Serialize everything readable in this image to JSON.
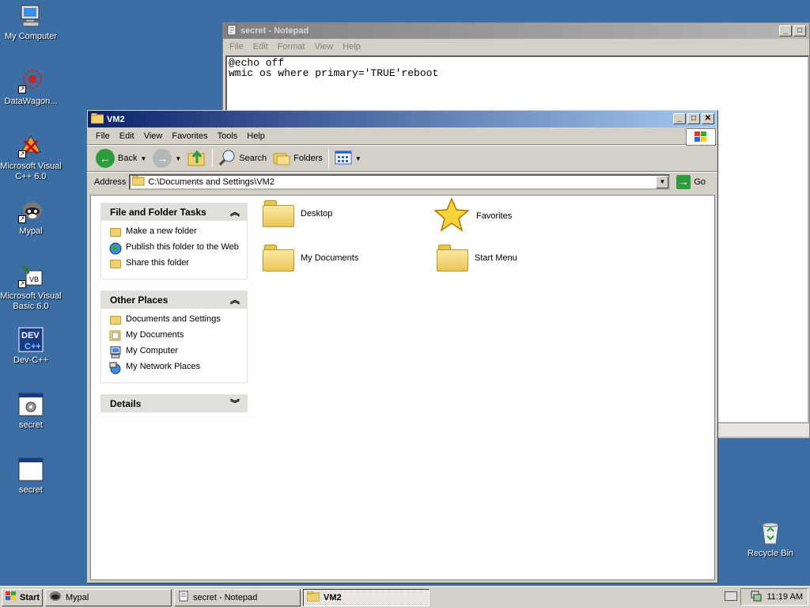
{
  "desktop": {
    "icons": [
      {
        "label": "My Computer"
      },
      {
        "label": "DataWagon..."
      },
      {
        "label": "Microsoft Visual C++ 6.0"
      },
      {
        "label": "Mypal"
      },
      {
        "label": "Microsoft Visual Basic 6.0"
      },
      {
        "label": "Dev-C++"
      },
      {
        "label": "secret"
      },
      {
        "label": "secret"
      },
      {
        "label": "Recycle Bin"
      }
    ]
  },
  "notepad": {
    "title": "secret - Notepad",
    "menu": [
      "File",
      "Edit",
      "Format",
      "View",
      "Help"
    ],
    "text": "@echo off\nwmic os where primary='TRUE'reboot"
  },
  "explorer": {
    "title": "VM2",
    "menu": [
      "File",
      "Edit",
      "View",
      "Favorites",
      "Tools",
      "Help"
    ],
    "toolbar": {
      "back": "Back",
      "search": "Search",
      "folders": "Folders"
    },
    "address": {
      "label": "Address",
      "value": "C:\\Documents and Settings\\VM2",
      "go": "Go"
    },
    "tasks_panel": {
      "title": "File and Folder Tasks",
      "items": [
        "Make a new folder",
        "Publish this folder to the Web",
        "Share this folder"
      ]
    },
    "places_panel": {
      "title": "Other Places",
      "items": [
        "Documents and Settings",
        "My Documents",
        "My Computer",
        "My Network Places"
      ]
    },
    "details_panel": {
      "title": "Details"
    },
    "items": [
      "Desktop",
      "Favorites",
      "My Documents",
      "Start Menu"
    ]
  },
  "taskbar": {
    "start": "Start",
    "buttons": [
      "Mypal",
      "secret - Notepad",
      "VM2"
    ],
    "clock": "11:19 AM"
  },
  "colors": {
    "desktop": "#3a6ea5",
    "active_title": "#0a246a",
    "inactive_title": "#808080"
  }
}
